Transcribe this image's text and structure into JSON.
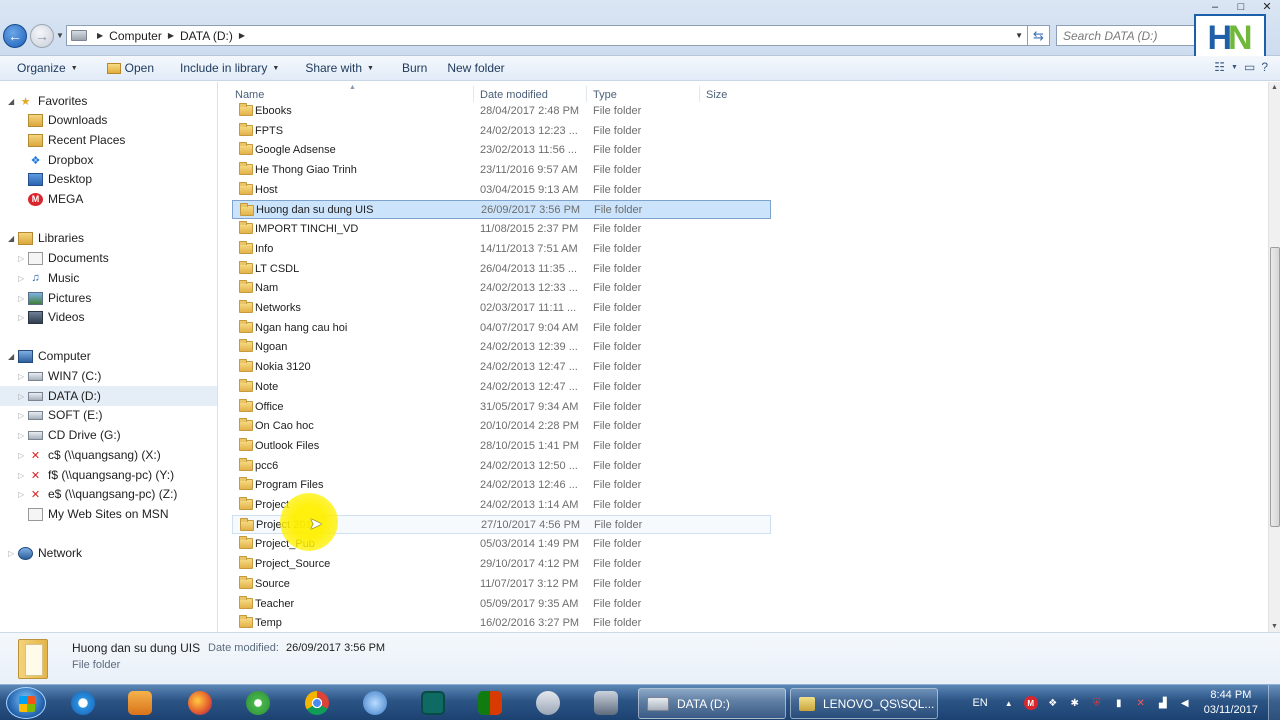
{
  "window": {
    "controls": [
      "–",
      "□",
      "✕"
    ]
  },
  "address": {
    "breadcrumb": [
      "Computer",
      "DATA (D:)"
    ],
    "search_placeholder": "Search DATA (D:)"
  },
  "logo": {
    "left": "H",
    "right": "N"
  },
  "toolbar": {
    "organize": "Organize",
    "open": "Open",
    "include": "Include in library",
    "share": "Share with",
    "burn": "Burn",
    "new_folder": "New folder"
  },
  "nav": {
    "favorites": "Favorites",
    "favorites_items": [
      "Downloads",
      "Recent Places",
      "Dropbox",
      "Desktop",
      "MEGA"
    ],
    "libraries": "Libraries",
    "libraries_items": [
      "Documents",
      "Music",
      "Pictures",
      "Videos"
    ],
    "computer": "Computer",
    "computer_items": [
      "WIN7 (C:)",
      "DATA (D:)",
      "SOFT (E:)",
      "CD Drive (G:)",
      "c$ (\\\\quangsang) (X:)",
      "f$ (\\\\quangsang-pc) (Y:)",
      "e$ (\\\\quangsang-pc) (Z:)",
      "My Web Sites on MSN"
    ],
    "network": "Network"
  },
  "columns": {
    "name": "Name",
    "date": "Date modified",
    "type": "Type",
    "size": "Size"
  },
  "files": [
    {
      "name": "Ebooks",
      "date": "28/04/2017 2:48 PM",
      "type": "File folder"
    },
    {
      "name": "FPTS",
      "date": "24/02/2013 12:23 ...",
      "type": "File folder"
    },
    {
      "name": "Google Adsense",
      "date": "23/02/2013 11:56 ...",
      "type": "File folder"
    },
    {
      "name": "He Thong Giao Trinh",
      "date": "23/11/2016 9:57 AM",
      "type": "File folder"
    },
    {
      "name": "Host",
      "date": "03/04/2015 9:13 AM",
      "type": "File folder"
    },
    {
      "name": "Huong dan su dung UIS",
      "date": "26/09/2017 3:56 PM",
      "type": "File folder"
    },
    {
      "name": "IMPORT TINCHI_VD",
      "date": "11/08/2015 2:37 PM",
      "type": "File folder"
    },
    {
      "name": "Info",
      "date": "14/11/2013 7:51 AM",
      "type": "File folder"
    },
    {
      "name": "LT CSDL",
      "date": "26/04/2013 11:35 ...",
      "type": "File folder"
    },
    {
      "name": "Nam",
      "date": "24/02/2013 12:33 ...",
      "type": "File folder"
    },
    {
      "name": "Networks",
      "date": "02/03/2017 11:11 ...",
      "type": "File folder"
    },
    {
      "name": "Ngan hang cau hoi",
      "date": "04/07/2017 9:04 AM",
      "type": "File folder"
    },
    {
      "name": "Ngoan",
      "date": "24/02/2013 12:39 ...",
      "type": "File folder"
    },
    {
      "name": "Nokia 3120",
      "date": "24/02/2013 12:47 ...",
      "type": "File folder"
    },
    {
      "name": "Note",
      "date": "24/02/2013 12:47 ...",
      "type": "File folder"
    },
    {
      "name": "Office",
      "date": "31/05/2017 9:34 AM",
      "type": "File folder"
    },
    {
      "name": "On Cao hoc",
      "date": "20/10/2014 2:28 PM",
      "type": "File folder"
    },
    {
      "name": "Outlook Files",
      "date": "28/10/2015 1:41 PM",
      "type": "File folder"
    },
    {
      "name": "pcc6",
      "date": "24/02/2013 12:50 ...",
      "type": "File folder"
    },
    {
      "name": "Program Files",
      "date": "24/02/2013 12:46 ...",
      "type": "File folder"
    },
    {
      "name": "Project",
      "date": "24/02/2013 1:14 AM",
      "type": "File folder"
    },
    {
      "name": "Project 2017",
      "date": "27/10/2017 4:56 PM",
      "type": "File folder"
    },
    {
      "name": "Project_Pub",
      "date": "05/03/2014 1:49 PM",
      "type": "File folder"
    },
    {
      "name": "Project_Source",
      "date": "29/10/2017 4:12 PM",
      "type": "File folder"
    },
    {
      "name": "Source",
      "date": "11/07/2017 3:12 PM",
      "type": "File folder"
    },
    {
      "name": "Teacher",
      "date": "05/09/2017 9:35 AM",
      "type": "File folder"
    },
    {
      "name": "Temp",
      "date": "16/02/2016 3:27 PM",
      "type": "File folder"
    }
  ],
  "details": {
    "name": "Huong dan su dung UIS",
    "date_label": "Date modified:",
    "date": "26/09/2017 3:56 PM",
    "type": "File folder"
  },
  "taskbar": {
    "task_explorer": "DATA (D:)",
    "task_sql": "LENOVO_QS\\SQL...",
    "lang": "EN",
    "time": "8:44 PM",
    "date": "03/11/2017"
  },
  "colors": {
    "selection": "#cce4fb",
    "selection_border": "#7da2ce",
    "highlight": "#fff000",
    "taskbar": "#2b5485"
  }
}
